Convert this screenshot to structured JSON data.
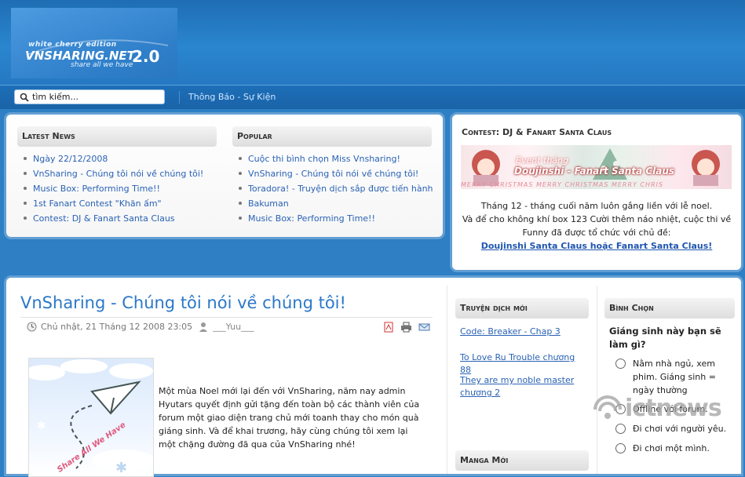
{
  "header": {
    "logo_edition": "white cherry edition",
    "logo_name": "VNSHARING.NET",
    "logo_version": "2.0",
    "logo_tagline": "share all we have"
  },
  "navbar": {
    "search_placeholder": "tìm kiếm...",
    "link": "Thông Báo - Sự Kiện"
  },
  "latest_news": {
    "title": "Latest News",
    "items": [
      "Ngày 22/12/2008",
      "VnSharing - Chúng tôi nói về chúng tôi!",
      "Music Box: Performing Time!!",
      "1st Fanart Contest \"Khăn ấm\"",
      "Contest: DJ & Fanart Santa Claus"
    ]
  },
  "popular": {
    "title": "Popular",
    "items": [
      "Cuộc thi bình chọn Miss Vnsharing!",
      "VnSharing - Chúng tôi nói về chúng tôi!",
      "Toradora! - Truyện dịch sắp được tiến hành",
      "Bakuman",
      "Music Box: Performing Time!!"
    ]
  },
  "contest": {
    "title": "Contest: DJ & Fanart Santa Claus",
    "banner_line1": "Event tháng",
    "banner_line2": "Doujinshi - Fanart Santa Claus",
    "banner_strip": "MERRY CHRISTMAS MERRY CHRISTMAS MERRY CHRIS",
    "body_line1": "Tháng 12 - tháng cuối năm luôn gắng liền với lễ noel.",
    "body_line2": "Và để cho không khí box 123 Cười thêm náo nhiệt, cuộc thi về Funny đã được tổ chức với chủ đề:",
    "cta": "Doujinshi Santa Claus hoặc Fanart Santa Claus!"
  },
  "article": {
    "title": "VnSharing - Chúng tôi nói về chúng tôi!",
    "date": "Chủ nhật, 21 Tháng 12 2008 23:05",
    "author": "___Yuu___",
    "thumb_text": "Share All We Have",
    "body": "Một mùa Noel mới lại đến với VnSharing, năm nay admin Hyutars quyết định gửi tặng đến toàn bộ các thành viên của forum một giao diện trang chủ mới toanh thay cho món quà giáng sinh. Và để khai trương, hãy cùng chúng tôi xem lại một chặng đường đã qua của VnSharing nhé!"
  },
  "translated": {
    "title": "Truyện dịch mới",
    "items": [
      "Code: Breaker - Chap 3",
      "To Love Ru Trouble chương 88",
      "They are my noble master chương 2"
    ]
  },
  "manga": {
    "title": "Manga Mới"
  },
  "poll": {
    "title": "Bình Chọn",
    "question": "Giáng sinh này bạn sẽ làm gì?",
    "options": [
      "Nằm nhà ngủ, xem phim. Giáng sinh = ngày thường",
      "Offline với forum.",
      "Đi chơi với người yêu.",
      "Đi chơi một mình."
    ]
  },
  "watermark": {
    "text": "ictnews"
  },
  "colors": {
    "brand_blue": "#2e7fc4",
    "link_blue": "#2a62b4",
    "title_blue": "#2b78c8"
  }
}
